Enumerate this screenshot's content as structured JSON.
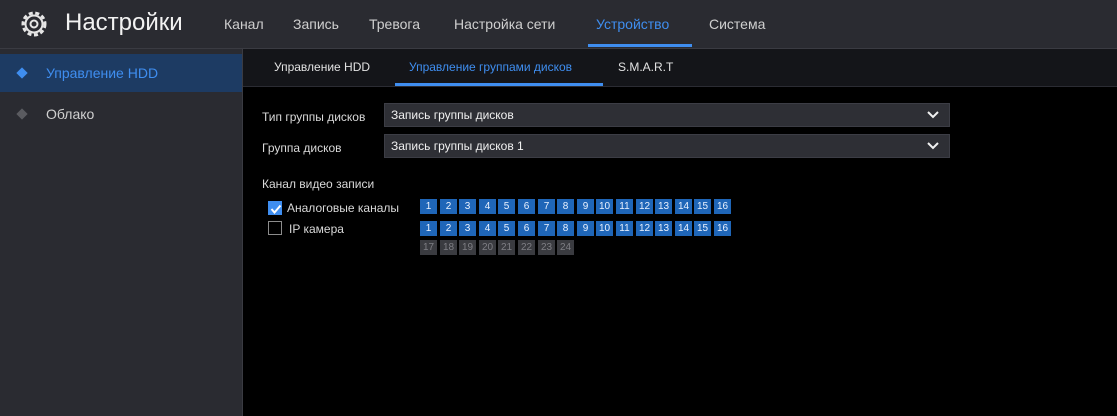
{
  "header": {
    "title": "Настройки",
    "tabs": [
      {
        "label": "Канал",
        "active": false
      },
      {
        "label": "Запись",
        "active": false
      },
      {
        "label": "Тревога",
        "active": false
      },
      {
        "label": "Настройка сети",
        "active": false
      },
      {
        "label": "Устройство",
        "active": true
      },
      {
        "label": "Система",
        "active": false
      }
    ]
  },
  "sidebar": {
    "items": [
      {
        "label": "Управление HDD",
        "active": true
      },
      {
        "label": "Облако",
        "active": false
      }
    ]
  },
  "subtabs": [
    {
      "label": "Управление HDD",
      "active": false
    },
    {
      "label": "Управление группами дисков",
      "active": true
    },
    {
      "label": "S.M.A.R.T",
      "active": false
    }
  ],
  "form": {
    "disk_group_type": {
      "label": "Тип группы дисков",
      "value": "Запись группы дисков"
    },
    "disk_group": {
      "label": "Группа дисков",
      "value": "Запись группы дисков 1"
    },
    "channels_heading": "Канал видео записи",
    "analog": {
      "label": "Аналоговые каналы",
      "checked": true,
      "channels": [
        "1",
        "2",
        "3",
        "4",
        "5",
        "6",
        "7",
        "8",
        "9",
        "10",
        "11",
        "12",
        "13",
        "14",
        "15",
        "16"
      ]
    },
    "ip": {
      "label": "IP камера",
      "checked": false,
      "channels_active": [
        "1",
        "2",
        "3",
        "4",
        "5",
        "6",
        "7",
        "8",
        "9",
        "10",
        "11",
        "12",
        "13",
        "14",
        "15",
        "16"
      ],
      "channels_disabled": [
        "17",
        "18",
        "19",
        "20",
        "21",
        "22",
        "23",
        "24"
      ]
    }
  },
  "colors": {
    "accent": "#3f8ef0",
    "channel_active": "#1f66b8",
    "channel_disabled": "#3a3b40",
    "sidebar_active": "#1d3b63"
  }
}
